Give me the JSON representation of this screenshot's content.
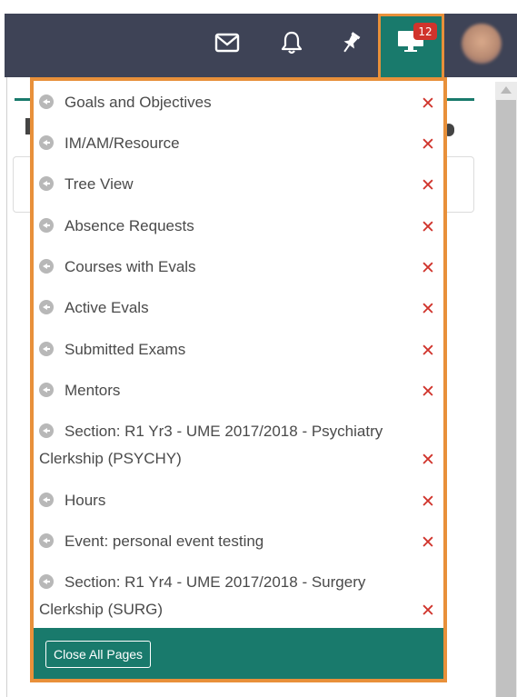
{
  "topbar": {
    "icons": [
      "mail-icon",
      "bell-icon",
      "pin-icon",
      "desktop-icon"
    ],
    "badge_count": "12",
    "colors": {
      "navbar": "#3e4356",
      "accent": "#197a6c",
      "highlight": "#e8903a",
      "close": "#d0342c"
    }
  },
  "dropdown": {
    "items": [
      {
        "label": "Goals and Objectives"
      },
      {
        "label": "IM/AM/Resource"
      },
      {
        "label": "Tree View"
      },
      {
        "label": "Absence Requests"
      },
      {
        "label": "Courses with Evals"
      },
      {
        "label": "Active Evals"
      },
      {
        "label": "Submitted Exams"
      },
      {
        "label": "Mentors"
      },
      {
        "label": "Section: R1 Yr3 - UME 2017/2018 - Psychiatry",
        "label_2": "Clerkship (PSYCHY)"
      },
      {
        "label": "Hours"
      },
      {
        "label": "Event: personal event testing"
      },
      {
        "label": "Section: R1 Yr4 - UME 2017/2018 - Surgery",
        "label_2": "Clerkship (SURG)"
      }
    ],
    "close_symbol": "✕",
    "close_all_label": "Close All Pages"
  }
}
